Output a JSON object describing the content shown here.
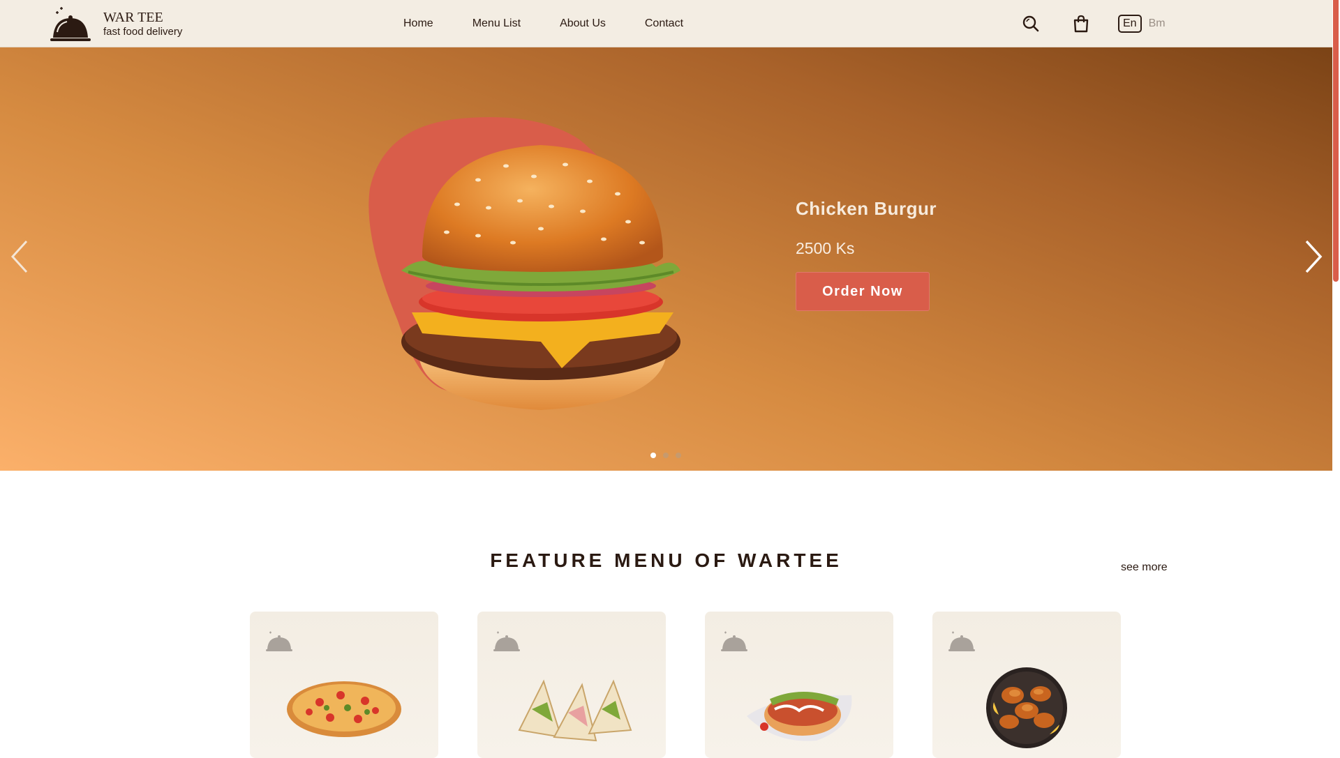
{
  "brand": {
    "name": "WAR TEE",
    "tagline": "fast food delivery",
    "icon": "cloche-icon"
  },
  "nav": {
    "items": [
      "Home",
      "Menu List",
      "About Us",
      "Contact"
    ]
  },
  "header_actions": {
    "search_icon": "search-icon",
    "cart_icon": "shopping-bag-icon",
    "lang_en": "En",
    "lang_bm": "Bm"
  },
  "hero": {
    "title": "Chicken Burgur",
    "price": "2500 Ks",
    "cta": "Order Now",
    "slides": 3,
    "active_slide": 1
  },
  "feature": {
    "title": "FEATURE MENU OF WARTEE",
    "see_more": "see more",
    "cards": [
      {
        "image": "pizza"
      },
      {
        "image": "sandwiches"
      },
      {
        "image": "hot-dog"
      },
      {
        "image": "fried-chicken"
      }
    ]
  },
  "colors": {
    "accent": "#d95d4a",
    "header_bg": "#f3ede3",
    "hero_dark": "#7b4316",
    "hero_light": "#fbb06a",
    "text": "#2b1a12"
  }
}
